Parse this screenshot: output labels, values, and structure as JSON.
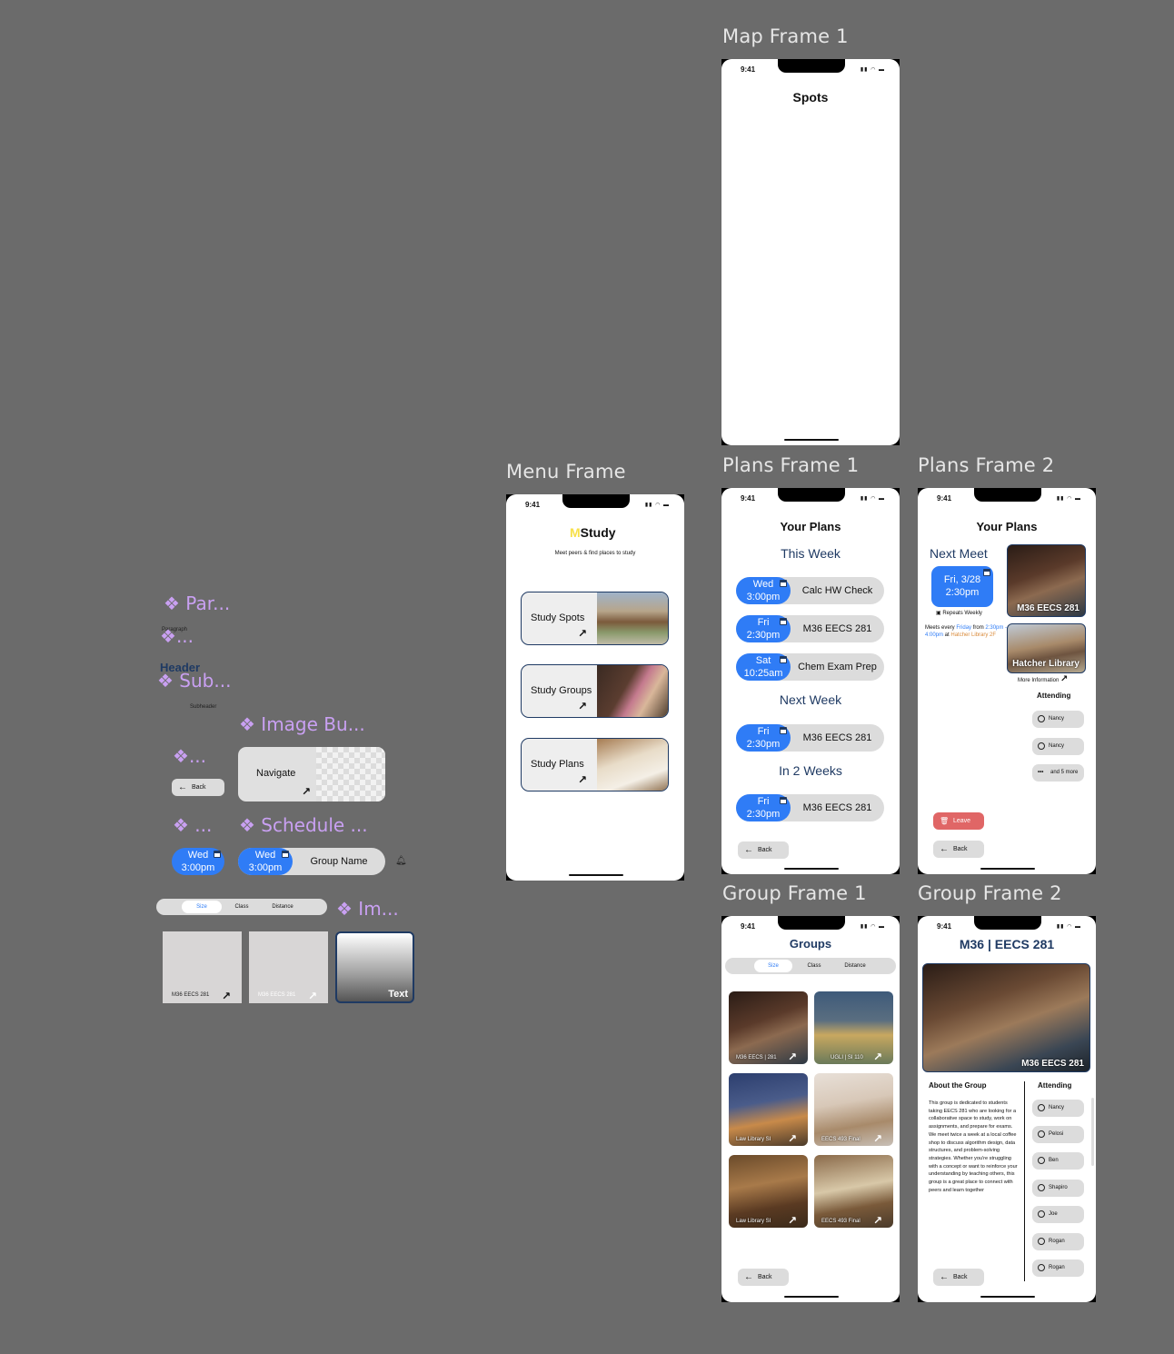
{
  "frames": {
    "map1": {
      "label": "Map Frame 1",
      "title": "Spots",
      "time": "9:41"
    },
    "menu": {
      "label": "Menu Frame",
      "time": "9:41",
      "logo_m": "M",
      "logo_rest": "Study",
      "subtitle": "Meet peers & find places to study",
      "buttons": [
        {
          "label": "Study Spots"
        },
        {
          "label": "Study Groups"
        },
        {
          "label": "Study Plans"
        }
      ]
    },
    "plans1": {
      "label": "Plans Frame 1",
      "time": "9:41",
      "title": "Your Plans",
      "sections": [
        {
          "heading": "This Week"
        },
        {
          "heading": "Next Week"
        },
        {
          "heading": "In 2 Weeks"
        }
      ],
      "items": [
        {
          "day": "Wed",
          "time": "3:00pm",
          "name": "Calc HW Check"
        },
        {
          "day": "Fri",
          "time": "2:30pm",
          "name": "M36 EECS 281"
        },
        {
          "day": "Sat",
          "time": "10:25am",
          "name": "Chem Exam Prep"
        },
        {
          "day": "Fri",
          "time": "2:30pm",
          "name": "M36 EECS 281"
        },
        {
          "day": "Fri",
          "time": "2:30pm",
          "name": "M36 EECS 281"
        }
      ],
      "back": "Back"
    },
    "plans2": {
      "label": "Plans Frame 2",
      "time": "9:41",
      "title": "Your Plans",
      "next_meet": "Next Meet",
      "date": "Fri, 3/28",
      "date_time": "2:30pm",
      "repeats": "Repeats Weekly",
      "meets_1": "Meets every ",
      "meets_day": "Friday",
      "meets_2": " from",
      "meets_time": "2:30pm - 4:00pm",
      "meets_3": " at",
      "meets_place": "Hatcher Library 2F",
      "img1_label": "M36 EECS 281",
      "img2_label": "Hatcher Library",
      "more_info": "More Information",
      "attending": "Attending",
      "attendees": [
        "Nancy",
        "Nancy"
      ],
      "more": "and 5 more",
      "leave": "Leave",
      "back": "Back"
    },
    "group1": {
      "label": "Group Frame 1",
      "time": "9:41",
      "title": "Groups",
      "tabs": [
        "Size",
        "Class",
        "Distance"
      ],
      "tiles": [
        "M36 EECS | 281",
        "UGLI | SI 110",
        "Law Library SI",
        "EECS 493 Final",
        "Law Library SI",
        "EECS 493 Final"
      ],
      "back": "Back"
    },
    "group2": {
      "label": "Group Frame 2",
      "time": "9:41",
      "title": "M36 | EECS 281",
      "img_label": "M36 EECS 281",
      "about_title": "About the Group",
      "about": "This group is dedicated to students taking EECS 281 who are looking for a collaborative space to study, work on assignments, and prepare for exams. We meet twice a week at a local coffee shop to discuss algorithm design, data structures, and problem-solving strategies. Whether you're struggling with a concept or want to reinforce your understanding by teaching others, this group is a great place to connect with peers and learn together",
      "attending": "Attending",
      "attendees": [
        "Nancy",
        "Pelosi",
        "Ben",
        "Shapiro",
        "Joe",
        "Rogan",
        "Rogan"
      ],
      "back": "Back"
    }
  },
  "components": {
    "par": "Par...",
    "paragraph": "Paragraph",
    "dots1": "...",
    "header": "Header",
    "sub": "Sub...",
    "subheader": "Subheader",
    "image_bu": "Image Bu...",
    "navigate": "Navigate",
    "dots2": "...",
    "back": "Back",
    "dots3": "...",
    "schedule": "Schedule ...",
    "sched_day": "Wed",
    "sched_time": "3:00pm",
    "group_name": "Group Name",
    "tabs": [
      "Size",
      "Class",
      "Distance"
    ],
    "im": "Im...",
    "tile1": "M36 EECS 281",
    "tile2": "M36 EECS 281",
    "tile3": "Text"
  },
  "colors": {
    "accent": "#2f7cf6",
    "navy": "#1f3a63",
    "leave": "#e06666",
    "canvas": "#6b6b6b",
    "component": "#c9a0f2"
  }
}
